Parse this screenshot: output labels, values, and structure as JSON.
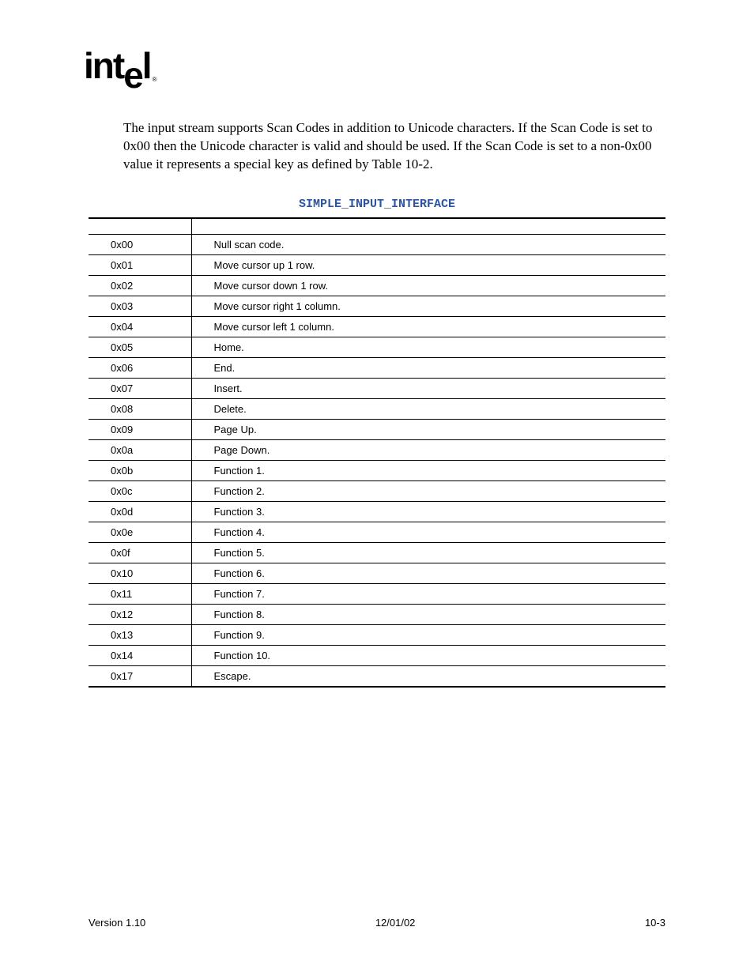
{
  "logo_text": "intel",
  "paragraph": "The input stream supports Scan Codes in addition to Unicode characters.  If the Scan Code is set to 0x00 then the Unicode character is valid and should be used.  If the Scan Code is set to a non-0x00 value it represents a special key as defined by Table 10-2.",
  "table_caption": "SIMPLE_INPUT_INTERFACE",
  "table": {
    "headers": [
      "",
      ""
    ],
    "rows": [
      {
        "code": "0x00",
        "desc": "Null scan code."
      },
      {
        "code": "0x01",
        "desc": "Move cursor up 1 row."
      },
      {
        "code": "0x02",
        "desc": "Move cursor down 1 row."
      },
      {
        "code": "0x03",
        "desc": "Move cursor right 1 column."
      },
      {
        "code": "0x04",
        "desc": "Move cursor left 1 column."
      },
      {
        "code": "0x05",
        "desc": "Home."
      },
      {
        "code": "0x06",
        "desc": "End."
      },
      {
        "code": "0x07",
        "desc": "Insert."
      },
      {
        "code": "0x08",
        "desc": "Delete."
      },
      {
        "code": "0x09",
        "desc": "Page Up."
      },
      {
        "code": "0x0a",
        "desc": "Page Down."
      },
      {
        "code": "0x0b",
        "desc": "Function 1."
      },
      {
        "code": "0x0c",
        "desc": "Function 2."
      },
      {
        "code": "0x0d",
        "desc": "Function 3."
      },
      {
        "code": "0x0e",
        "desc": "Function 4."
      },
      {
        "code": "0x0f",
        "desc": "Function 5."
      },
      {
        "code": "0x10",
        "desc": "Function 6."
      },
      {
        "code": "0x11",
        "desc": "Function 7."
      },
      {
        "code": "0x12",
        "desc": "Function 8."
      },
      {
        "code": "0x13",
        "desc": "Function 9."
      },
      {
        "code": "0x14",
        "desc": "Function 10."
      },
      {
        "code": "0x17",
        "desc": "Escape."
      }
    ]
  },
  "footer": {
    "left": "Version 1.10",
    "center": "12/01/02",
    "right": "10-3"
  }
}
